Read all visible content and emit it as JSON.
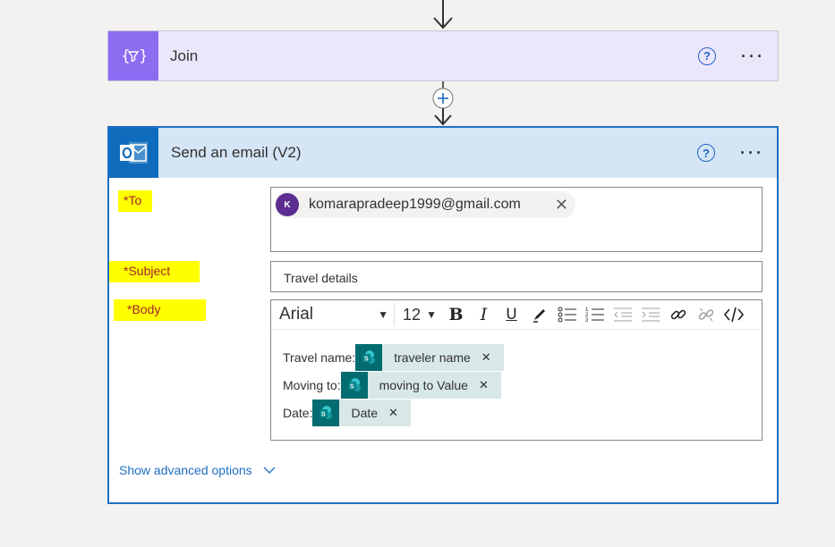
{
  "join": {
    "title": "Join",
    "icon": "join-expression-icon",
    "help": "?",
    "more": "···"
  },
  "connector": {
    "add_icon": "plus-icon"
  },
  "email": {
    "title": "Send an email (V2)",
    "icon": "outlook-icon",
    "help": "?",
    "more": "···",
    "to": {
      "label": "To",
      "required_mark": "*",
      "recipient": {
        "initial": "K",
        "address": "komarapradeep1999@gmail.com"
      }
    },
    "subject": {
      "label": "Subject",
      "required_mark": "*",
      "value": "Travel details"
    },
    "body": {
      "label": "Body",
      "required_mark": "*",
      "font": "Arial",
      "font_size": "12",
      "lines": [
        {
          "label": "Travel name:",
          "token": "traveler name"
        },
        {
          "label": "Moving to:",
          "token": "moving to Value"
        },
        {
          "label": "Date:",
          "token": "Date"
        }
      ]
    },
    "advanced_label": "Show advanced options"
  },
  "colors": {
    "join_accent": "#8c6cf0",
    "email_accent": "#0f6cbd",
    "highlight": "#ffff00",
    "token_icon": "#036c70"
  }
}
